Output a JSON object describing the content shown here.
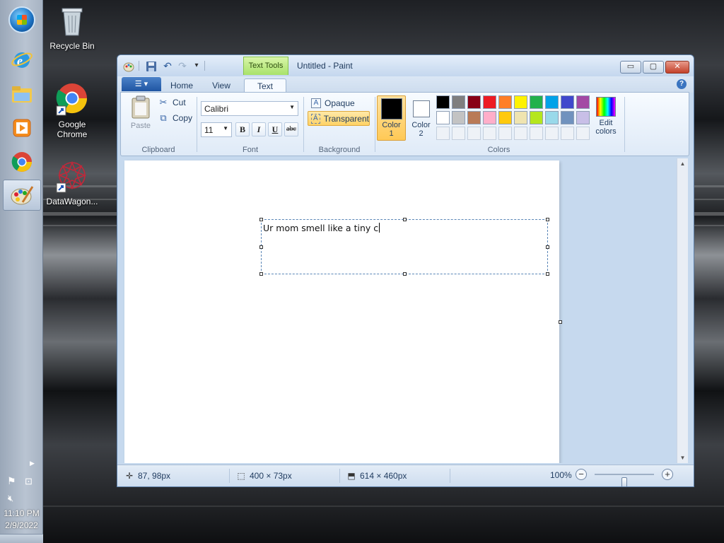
{
  "desktop": {
    "icons": [
      {
        "label": "Recycle Bin",
        "icon": "recycle-bin-icon"
      },
      {
        "label": "Google Chrome",
        "icon": "chrome-icon"
      },
      {
        "label": "DataWagon...",
        "icon": "datawagon-icon"
      }
    ]
  },
  "taskbar": {
    "pinned": [
      "start-orb",
      "internet-explorer-icon",
      "file-explorer-icon",
      "media-player-icon",
      "chrome-icon",
      "paint-icon"
    ],
    "active": "paint-icon",
    "time": "11:10 PM",
    "date": "2/9/2022"
  },
  "window": {
    "title": "Untitled - Paint",
    "contextual_tab": "Text Tools",
    "caption_buttons": {
      "minimize": "▭",
      "maximize": "▢",
      "close": "✕"
    },
    "qat_customize": "▾",
    "tabs": [
      {
        "label": "Home",
        "selected": false
      },
      {
        "label": "View",
        "selected": false
      },
      {
        "label": "Text",
        "selected": true
      }
    ],
    "ribbon": {
      "clipboard": {
        "paste": "Paste",
        "cut": "Cut",
        "copy": "Copy",
        "label": "Clipboard"
      },
      "font": {
        "family": "Calibri",
        "size": "11",
        "bold": "B",
        "italic": "I",
        "underline": "U",
        "strikethrough": "abc",
        "label": "Font"
      },
      "background": {
        "opaque": "Opaque",
        "transparent": "Transparent",
        "selected": "transparent",
        "label": "Background"
      },
      "colors": {
        "color1_label": "Color",
        "color1_num": "1",
        "color2_label": "Color",
        "color2_num": "2",
        "color1": "#000000",
        "color2": "#ffffff",
        "edit_line1": "Edit",
        "edit_line2": "colors",
        "label": "Colors",
        "palette_row1": [
          "#000000",
          "#7f7f7f",
          "#880015",
          "#ed1c24",
          "#ff7f27",
          "#fff200",
          "#22b14c",
          "#00a2e8",
          "#3f48cc",
          "#a349a4"
        ],
        "palette_row2": [
          "#ffffff",
          "#c3c3c3",
          "#b97a57",
          "#ffaec9",
          "#ffc90e",
          "#efe4b0",
          "#b5e61d",
          "#99d9ea",
          "#7092be",
          "#c8bfe7"
        ]
      }
    },
    "canvas": {
      "text": "Ur mom smell like a tiny c"
    },
    "status": {
      "cursor": "87, 98px",
      "selection": "400 × 73px",
      "canvas_size": "614 × 460px",
      "zoom": "100%",
      "zoom_level": 0.5
    }
  }
}
